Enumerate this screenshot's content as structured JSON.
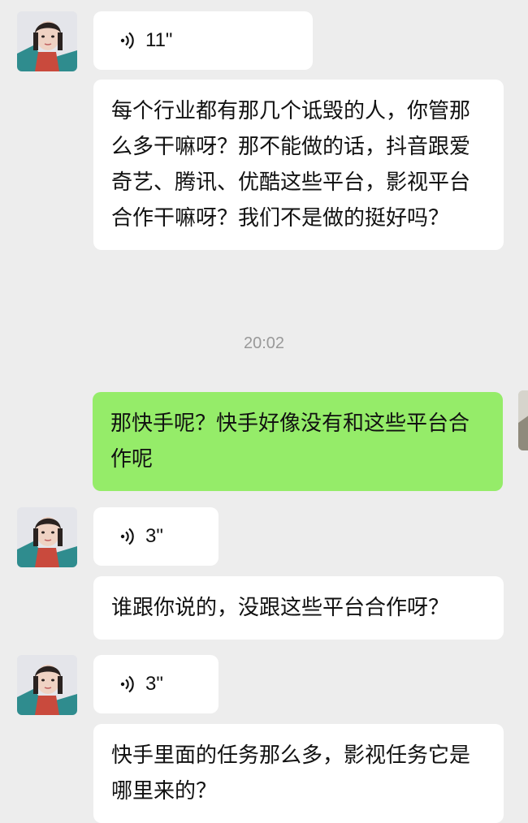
{
  "chat": {
    "timestamp": "20:02",
    "messages": [
      {
        "type": "voice",
        "sender": "other",
        "duration": "11\""
      },
      {
        "type": "text",
        "sender": "other",
        "text": "每个行业都有那几个诋毁的人，你管那么多干嘛呀？那不能做的话，抖音跟爱奇艺、腾讯、优酷这些平台，影视平台合作干嘛呀？我们不是做的挺好吗？"
      },
      {
        "type": "text",
        "sender": "me",
        "text": "那快手呢？快手好像没有和这些平台合作呢"
      },
      {
        "type": "voice",
        "sender": "other",
        "duration": "3\""
      },
      {
        "type": "text",
        "sender": "other",
        "text": "谁跟你说的，没跟这些平台合作呀？"
      },
      {
        "type": "voice",
        "sender": "other",
        "duration": "3\""
      },
      {
        "type": "text",
        "sender": "other",
        "text": "快手里面的任务那么多，影视任务它是哪里来的？"
      }
    ]
  },
  "colors": {
    "background": "#ededed",
    "incoming_bubble": "#ffffff",
    "outgoing_bubble": "#95ec69",
    "timestamp": "#999999"
  }
}
